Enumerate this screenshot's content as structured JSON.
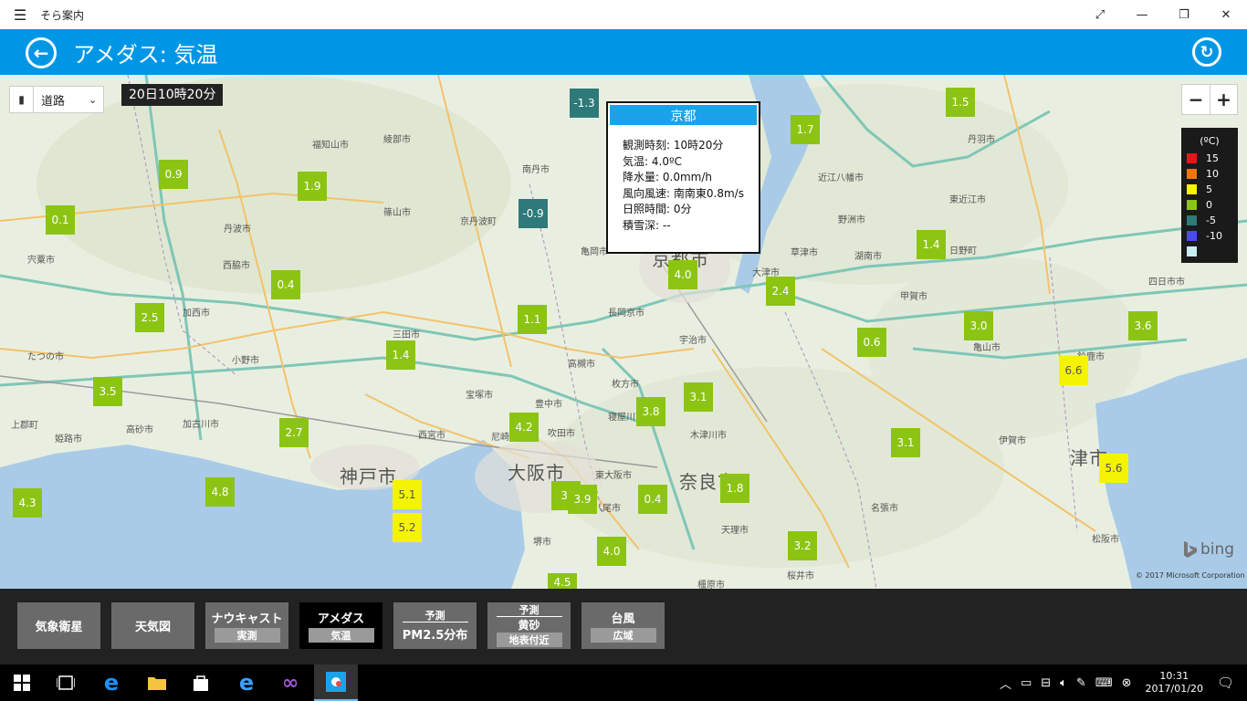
{
  "app": {
    "title": "そら案内",
    "menu_icon": "hamburger-icon",
    "window_buttons": [
      "fullscreen-icon",
      "minimize-icon",
      "maximize-icon",
      "close-icon"
    ]
  },
  "header": {
    "title": "アメダス: 気温",
    "back_icon": "back-arrow-icon",
    "refresh_icon": "refresh-icon",
    "background": "#0096e6"
  },
  "map": {
    "layer": "道路",
    "timestamp": "20日10時20分",
    "zoom_out": "−",
    "zoom_in": "+",
    "big_labels": [
      "京都市",
      "大阪市",
      "神戸市",
      "奈良市",
      "津市"
    ],
    "place_labels": [
      "福知山市",
      "綾部市",
      "南丹市",
      "京丹波町",
      "丹波市",
      "篠山市",
      "三田市",
      "西脇市",
      "加西市",
      "小野市",
      "加古川市",
      "姫路市",
      "高砂市",
      "宝塚市",
      "西宮市",
      "尼崎市",
      "豊中市",
      "吹田市",
      "高槻市",
      "枚方市",
      "寝屋川市",
      "東大阪市",
      "八尾市",
      "堺市",
      "長岡京市",
      "宇治市",
      "亀岡市",
      "木津川市",
      "大津市",
      "草津市",
      "甲賀市",
      "伊賀市",
      "名張市",
      "天理市",
      "桜井市",
      "橿原市",
      "松阪市",
      "鈴鹿市",
      "亀山市",
      "東近江市",
      "近江八幡市",
      "野洲市",
      "湖南市",
      "四日市市",
      "日野町",
      "丹羽市",
      "上郡町",
      "たつの市",
      "宍粟市"
    ],
    "stations": [
      {
        "value": "-1.3",
        "color": "teal"
      },
      {
        "value": "1.5",
        "color": "green"
      },
      {
        "value": "1.7",
        "color": "green"
      },
      {
        "value": "0.9",
        "color": "green"
      },
      {
        "value": "1.9",
        "color": "green"
      },
      {
        "value": "-0.9",
        "color": "teal"
      },
      {
        "value": "0.1",
        "color": "green"
      },
      {
        "value": "1.4",
        "color": "green"
      },
      {
        "value": "4.0",
        "color": "green"
      },
      {
        "value": "0.4",
        "color": "green"
      },
      {
        "value": "2.4",
        "color": "green"
      },
      {
        "value": "2.5",
        "color": "green"
      },
      {
        "value": "1.1",
        "color": "green"
      },
      {
        "value": "3.0",
        "color": "green"
      },
      {
        "value": "3.6",
        "color": "green"
      },
      {
        "value": "1.4",
        "color": "green"
      },
      {
        "value": "0.6",
        "color": "green"
      },
      {
        "value": "6.6",
        "color": "yellow"
      },
      {
        "value": "3.5",
        "color": "green"
      },
      {
        "value": "3.1",
        "color": "green"
      },
      {
        "value": "3.8",
        "color": "green"
      },
      {
        "value": "2.7",
        "color": "green"
      },
      {
        "value": "4.2",
        "color": "green"
      },
      {
        "value": "3.1",
        "color": "green"
      },
      {
        "value": "5.6",
        "color": "yellow"
      },
      {
        "value": "4.8",
        "color": "green"
      },
      {
        "value": "5.1",
        "color": "yellow"
      },
      {
        "value": "3.",
        "color": "green"
      },
      {
        "value": "3.9",
        "color": "green"
      },
      {
        "value": "0.4",
        "color": "green"
      },
      {
        "value": "1.8",
        "color": "green"
      },
      {
        "value": "4.3",
        "color": "green"
      },
      {
        "value": "5.2",
        "color": "yellow"
      },
      {
        "value": "4.0",
        "color": "green"
      },
      {
        "value": "3.2",
        "color": "green"
      },
      {
        "value": "4.5",
        "color": "green"
      }
    ],
    "popup": {
      "title": "京都",
      "rows": [
        {
          "label": "観測時刻:",
          "value": "10時20分"
        },
        {
          "label": "気温:",
          "value": "4.0ºC"
        },
        {
          "label": "降水量:",
          "value": "0.0mm/h"
        },
        {
          "label": "風向風速:",
          "value": "南南東0.8m/s"
        },
        {
          "label": "日照時間:",
          "value": "0分"
        },
        {
          "label": "積雪深:",
          "value": "--"
        }
      ]
    },
    "legend": {
      "unit": "(ºC)",
      "items": [
        {
          "label": "15",
          "color": "#e8141c"
        },
        {
          "label": "10",
          "color": "#f07800"
        },
        {
          "label": "5",
          "color": "#f4f400"
        },
        {
          "label": "0",
          "color": "#8cc414"
        },
        {
          "label": "-5",
          "color": "#2e7a7a"
        },
        {
          "label": "-10",
          "color": "#4a4af0"
        },
        {
          "label": "",
          "color": "#c8ecf4"
        }
      ]
    },
    "bing": "bing",
    "copyright": "© 2017 Microsoft Corporation"
  },
  "buttons": [
    {
      "top": "",
      "label": "気象衛星",
      "sub": ""
    },
    {
      "top": "",
      "label": "天気図",
      "sub": ""
    },
    {
      "top": "",
      "label": "ナウキャスト",
      "sub": "実測"
    },
    {
      "top": "",
      "label": "アメダス",
      "sub": "気温",
      "active": true
    },
    {
      "top": "予測",
      "label": "PM2.5分布",
      "sub": ""
    },
    {
      "top": "予測",
      "label": "黄砂",
      "sub": "地表付近"
    },
    {
      "top": "",
      "label": "台風",
      "sub": "広域"
    }
  ],
  "taskbar": {
    "icons": [
      "windows-start-icon",
      "task-view-icon",
      "edge-browser-icon",
      "file-explorer-icon",
      "store-icon",
      "internet-explorer-icon",
      "visual-studio-icon",
      "sora-annai-app-icon"
    ],
    "time": "10:31",
    "date": "2017/01/20"
  },
  "colors": {
    "accent": "#0096e6",
    "marker_green": "#8cc414",
    "marker_teal": "#2e7a7a",
    "marker_yellow": "#f4f400"
  }
}
